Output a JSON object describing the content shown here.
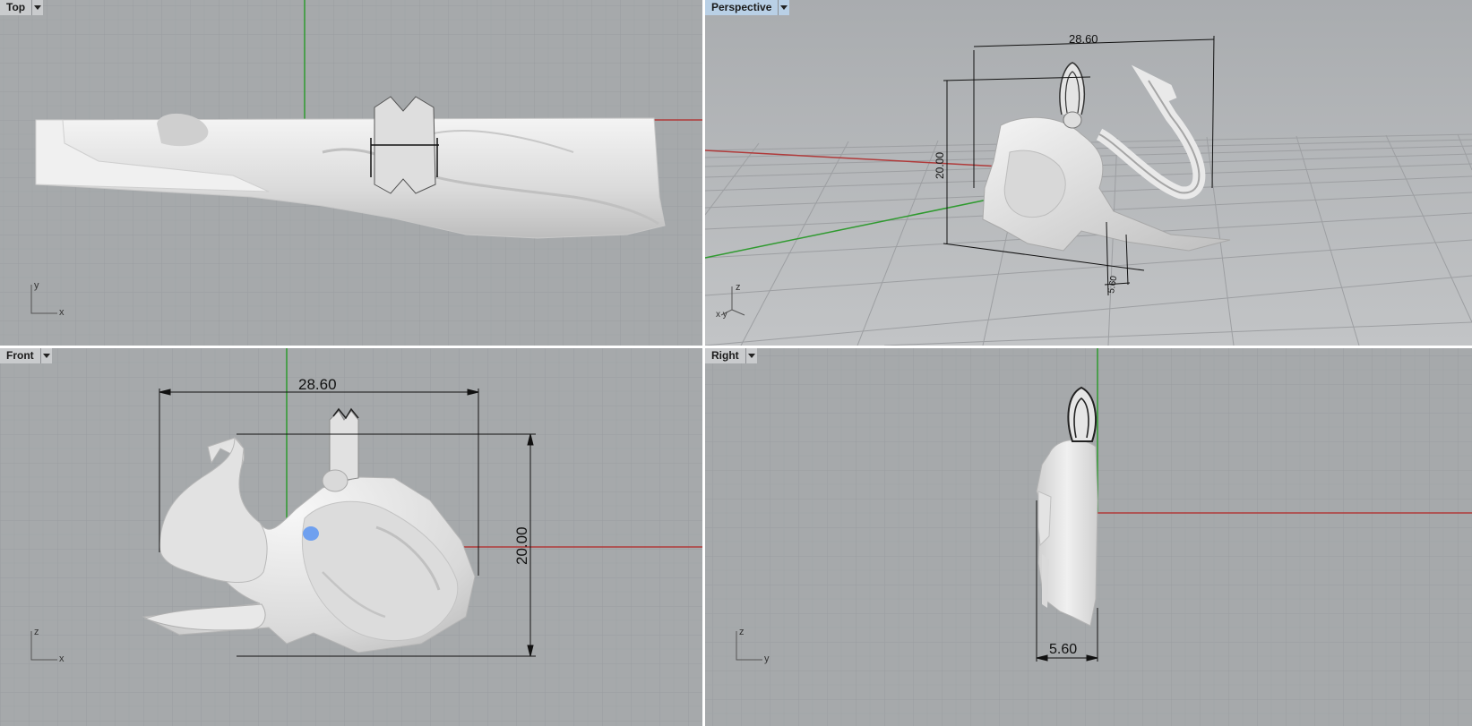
{
  "viewports": {
    "top": {
      "label": "Top"
    },
    "perspective": {
      "label": "Perspective"
    },
    "front": {
      "label": "Front"
    },
    "right": {
      "label": "Right"
    }
  },
  "axes": {
    "top": {
      "v": "y",
      "h": "x"
    },
    "perspective": {
      "v": "z",
      "h": "x y"
    },
    "front": {
      "v": "z",
      "h": "x"
    },
    "right": {
      "v": "z",
      "h": "y"
    }
  },
  "dimensions": {
    "width": "28.60",
    "height": "20.00",
    "depth": "5.60"
  },
  "colors": {
    "viewport_bg": "#a6a9ab",
    "grid_minor": "#9a9da0",
    "grid_major": "#8e9194",
    "x_axis": "#b03a3a",
    "y_axis": "#2f9a2f",
    "model": "#e4e4e4",
    "eye_highlight": "#6fa0ef",
    "active_tab": "#b9d0e6"
  }
}
